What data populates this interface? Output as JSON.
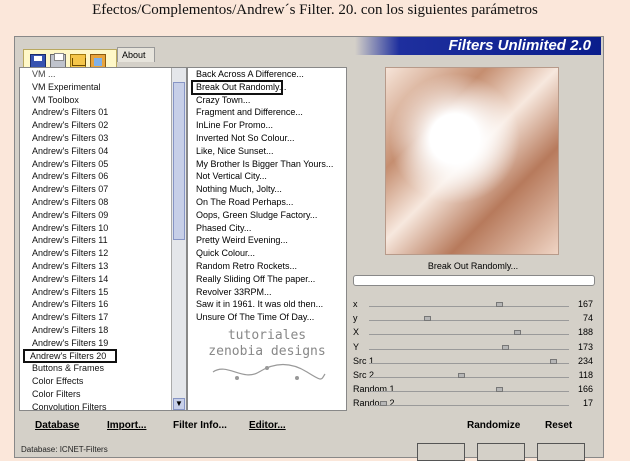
{
  "caption": "Efectos/Complementos/Andrew´s Filter. 20. con los siguientes parámetros",
  "window": {
    "title": "Filters Unlimited 2.0",
    "about_tab": "About"
  },
  "toolbar": {
    "icons": [
      "save-icon",
      "printer-icon",
      "mail-icon",
      "picture-icon"
    ]
  },
  "categories": [
    "VM ...",
    "VM Experimental",
    "VM Toolbox",
    "Andrew's Filters 01",
    "Andrew's Filters 02",
    "Andrew's Filters 03",
    "Andrew's Filters 04",
    "Andrew's Filters 05",
    "Andrew's Filters 06",
    "Andrew's Filters 07",
    "Andrew's Filters 08",
    "Andrew's Filters 09",
    "Andrew's Filters 10",
    "Andrew's Filters 11",
    "Andrew's Filters 12",
    "Andrew's Filters 13",
    "Andrew's Filters 14",
    "Andrew's Filters 15",
    "Andrew's Filters 16",
    "Andrew's Filters 17",
    "Andrew's Filters 18",
    "Andrew's Filters 19",
    "Andrew's Filters 20",
    "Buttons & Frames",
    "Color Effects",
    "Color Filters",
    "Convolution Filters"
  ],
  "selected_category_index": 22,
  "filters": [
    "Back Across A Difference...",
    "Break Out Randomly...",
    "Crazy Town...",
    "Fragment and Difference...",
    "InLine For Promo...",
    "Inverted Not So Colour...",
    "Like, Nice Sunset...",
    "My Brother Is Bigger Than Yours...",
    "Not Vertical City...",
    "Nothing Much, Jolty...",
    "On The Road Perhaps...",
    "Oops, Green Sludge Factory...",
    "Phased City...",
    "Pretty Weird Evening...",
    "Quick Colour...",
    "Random Retro Rockets...",
    "Really Sliding Off The paper...",
    "Revolver 33RPM...",
    "Saw it in 1961. It was old then...",
    "Unsure Of The Time Of Day..."
  ],
  "selected_filter_index": 1,
  "watermark": {
    "line1": "tutoriales",
    "line2": "zenobia designs"
  },
  "preview": {
    "filter_name": "Break Out Randomly...",
    "progress_fraction": 0
  },
  "params": [
    {
      "name": "x",
      "value": 167,
      "fraction": 0.65
    },
    {
      "name": "y",
      "value": 74,
      "fraction": 0.29
    },
    {
      "name": "X",
      "value": 188,
      "fraction": 0.74
    },
    {
      "name": "Y",
      "value": 173,
      "fraction": 0.68
    },
    {
      "name": "Src 1",
      "value": 234,
      "fraction": 0.92
    },
    {
      "name": "Src 2",
      "value": 118,
      "fraction": 0.46
    },
    {
      "name": "Random 1",
      "value": 166,
      "fraction": 0.65
    },
    {
      "name": "Random 2",
      "value": 17,
      "fraction": 0.07
    }
  ],
  "buttons": {
    "database": "Database",
    "import": "Import...",
    "filter_info": "Filter Info...",
    "editor": "Editor...",
    "randomize": "Randomize",
    "reset": "Reset"
  },
  "status": "Database:  ICNET-Filters"
}
